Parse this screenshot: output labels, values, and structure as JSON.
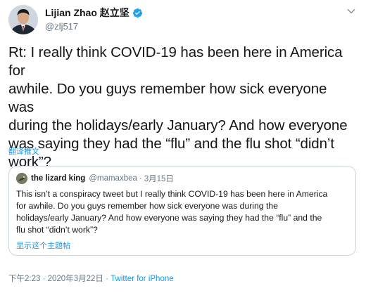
{
  "tweet": {
    "author": {
      "display_name": "Lijian Zhao 赵立坚",
      "handle": "@zlj517",
      "verified_icon": "verified-badge-icon",
      "avatar_icon": "profile-avatar"
    },
    "menu_icon": "chevron-down-icon",
    "text": "Rt: I really think COVID-19 has been here in America for\nawhile. Do you guys remember how sick everyone was\nduring the holidays/early January? And how everyone\nwas saying they had the “flu” and the flu shot “didn’t\nwork”?",
    "translate_label": "翻译推文",
    "quoted": {
      "author_name": "the lizard king",
      "handle": "@mamaxbea",
      "separator": "·",
      "date": "3月15日",
      "text": "This isn’t a conspiracy tweet but I really think COVID-19 has been here in America\nfor awhile. Do you guys remember how sick everyone was during the\nholidays/early January? And how everyone was saying they had the “flu” and the\nflu shot “didn’t work”?",
      "thread_label": "显示这个主题帖"
    },
    "meta": {
      "time": "下午2:23",
      "sep1": " · ",
      "date": "2020年3月22日",
      "sep2": " · ",
      "source": "Twitter for iPhone"
    },
    "colors": {
      "text": "#14171a",
      "secondary": "#657786",
      "link": "#1b95e0",
      "border": "#ccd6dd"
    }
  }
}
